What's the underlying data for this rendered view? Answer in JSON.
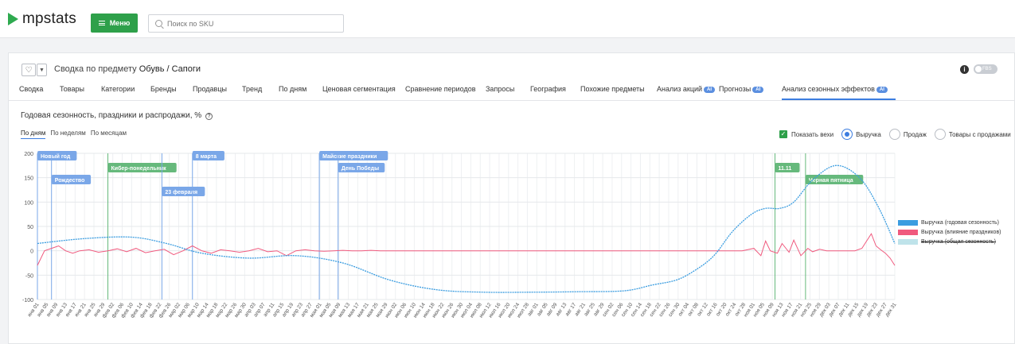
{
  "header": {
    "logo_text": "mpstats",
    "menu_label": "Меню",
    "search_placeholder": "Поиск по SKU"
  },
  "page": {
    "title_prefix": "Сводка по предмету",
    "title_subject": "Обувь / Сапоги",
    "fbs_label": "FBS",
    "info_icon": "i"
  },
  "tabs": [
    {
      "label": "Сводка"
    },
    {
      "label": "Товары"
    },
    {
      "label": "Категории"
    },
    {
      "label": "Бренды"
    },
    {
      "label": "Продавцы"
    },
    {
      "label": "Тренд"
    },
    {
      "label": "По дням"
    },
    {
      "label": "Ценовая сегментация"
    },
    {
      "label": "Сравнение периодов"
    },
    {
      "label": "Запросы"
    },
    {
      "label": "География"
    },
    {
      "label": "Похожие предметы"
    },
    {
      "label": "Анализ акций",
      "badge": "AI"
    },
    {
      "label": "Прогнозы",
      "badge": "AI"
    },
    {
      "label": "Анализ сезонных эффектов",
      "badge": "AI",
      "active": true
    }
  ],
  "section": {
    "title": "Годовая сезонность, праздники и распродажи, %",
    "help_icon": "?",
    "subtabs": [
      "По дням",
      "По неделям",
      "По месяцам"
    ],
    "show_milestones_label": "Показать вехи",
    "radio_options": [
      "Выручка",
      "Продаж",
      "Товары с продажами"
    ]
  },
  "chart_data": {
    "type": "line",
    "ylim": [
      -100,
      200
    ],
    "yticks": [
      200,
      150,
      100,
      50,
      0,
      -50,
      -100
    ],
    "grid": true,
    "legend_position": "right",
    "xtick_labels": [
      "янв 01",
      "янв 05",
      "янв 09",
      "янв 13",
      "янв 17",
      "янв 21",
      "янв 25",
      "янв 29",
      "фев 02",
      "фев 06",
      "фев 10",
      "фев 14",
      "фев 18",
      "фев 22",
      "фев 26",
      "мар 02",
      "мар 06",
      "мар 10",
      "мар 14",
      "мар 18",
      "мар 22",
      "мар 26",
      "мар 30",
      "апр 03",
      "апр 07",
      "апр 11",
      "апр 15",
      "апр 19",
      "апр 23",
      "апр 27",
      "мая 01",
      "мая 05",
      "мая 09",
      "мая 13",
      "мая 17",
      "мая 21",
      "мая 25",
      "мая 29",
      "июн 02",
      "июн 06",
      "июн 10",
      "июн 14",
      "июн 18",
      "июн 22",
      "июн 26",
      "июн 30",
      "июл 04",
      "июл 08",
      "июл 12",
      "июл 16",
      "июл 20",
      "июл 24",
      "июл 28",
      "авг 01",
      "авг 05",
      "авг 09",
      "авг 13",
      "авг 17",
      "авг 21",
      "авг 25",
      "авг 29",
      "сен 02",
      "сен 06",
      "сен 10",
      "сен 14",
      "сен 18",
      "сен 22",
      "сен 26",
      "сен 30",
      "окт 04",
      "окт 08",
      "окт 12",
      "окт 16",
      "окт 20",
      "окт 24",
      "окт 28",
      "ноя 01",
      "ноя 05",
      "ноя 09",
      "ноя 13",
      "ноя 17",
      "ноя 21",
      "ноя 25",
      "ноя 29",
      "дек 03",
      "дек 07",
      "дек 11",
      "дек 15",
      "дек 19",
      "дек 23",
      "дек 27",
      "дек 31"
    ],
    "series": [
      {
        "name": "Выручка (годовая сезонность)",
        "color": "#3b9de0",
        "x_day": [
          0,
          20,
          40,
          55,
          70,
          90,
          110,
          130,
          150,
          170,
          190,
          210,
          230,
          250,
          262,
          272,
          280,
          288,
          296,
          304,
          310,
          316,
          322,
          330,
          340,
          350,
          358,
          365
        ],
        "values": [
          15,
          25,
          28,
          15,
          -5,
          -15,
          -10,
          -25,
          -60,
          -80,
          -85,
          -85,
          -84,
          -82,
          -70,
          -60,
          -40,
          -10,
          40,
          75,
          87,
          87,
          100,
          145,
          175,
          150,
          90,
          15
        ]
      },
      {
        "name": "Выручка (влияние праздников)",
        "color": "#f05a7e",
        "x_day": [
          0,
          3,
          6,
          9,
          12,
          15,
          18,
          22,
          26,
          30,
          34,
          38,
          42,
          46,
          50,
          54,
          58,
          62,
          66,
          70,
          74,
          78,
          82,
          86,
          90,
          94,
          98,
          102,
          106,
          110,
          114,
          118,
          122,
          126,
          130,
          134,
          138,
          142,
          146,
          150,
          160,
          200,
          250,
          300,
          305,
          308,
          310,
          312,
          315,
          317,
          320,
          322,
          325,
          328,
          330,
          333,
          336,
          340,
          344,
          348,
          351,
          353,
          355,
          357,
          359,
          361,
          363,
          365
        ],
        "values": [
          -30,
          0,
          5,
          10,
          0,
          -5,
          0,
          2,
          -3,
          0,
          4,
          -2,
          5,
          -4,
          0,
          3,
          -8,
          0,
          10,
          0,
          -5,
          2,
          0,
          -3,
          0,
          5,
          -2,
          0,
          -10,
          0,
          2,
          0,
          -1,
          0,
          1,
          0,
          0,
          1,
          0,
          0,
          0,
          0,
          0,
          0,
          5,
          -10,
          20,
          0,
          -5,
          15,
          -3,
          22,
          -10,
          5,
          -2,
          3,
          0,
          0,
          0,
          0,
          5,
          20,
          35,
          10,
          2,
          -5,
          -15,
          -30
        ]
      },
      {
        "name": "Выручка (общая сезонность)",
        "color": "#bfe3ea",
        "hidden": true
      }
    ],
    "milestones": [
      {
        "label": "Новый год",
        "day": 0,
        "color": "#7aa7e8",
        "row": 0
      },
      {
        "label": "Рождество",
        "day": 6,
        "color": "#7aa7e8",
        "row": 2
      },
      {
        "label": "Кибер-понедельник",
        "day": 30,
        "color": "#66b97c",
        "row": 1
      },
      {
        "label": "23 февраля",
        "day": 53,
        "color": "#7aa7e8",
        "row": 3
      },
      {
        "label": "8 марта",
        "day": 66,
        "color": "#7aa7e8",
        "row": 0
      },
      {
        "label": "Майские праздники",
        "day": 120,
        "color": "#7aa7e8",
        "row": 0
      },
      {
        "label": "День Победы",
        "day": 128,
        "color": "#7aa7e8",
        "row": 1
      },
      {
        "label": "11.11",
        "day": 314,
        "color": "#66b97c",
        "row": 1
      },
      {
        "label": "Черная пятница",
        "day": 327,
        "color": "#66b97c",
        "row": 2
      }
    ]
  }
}
